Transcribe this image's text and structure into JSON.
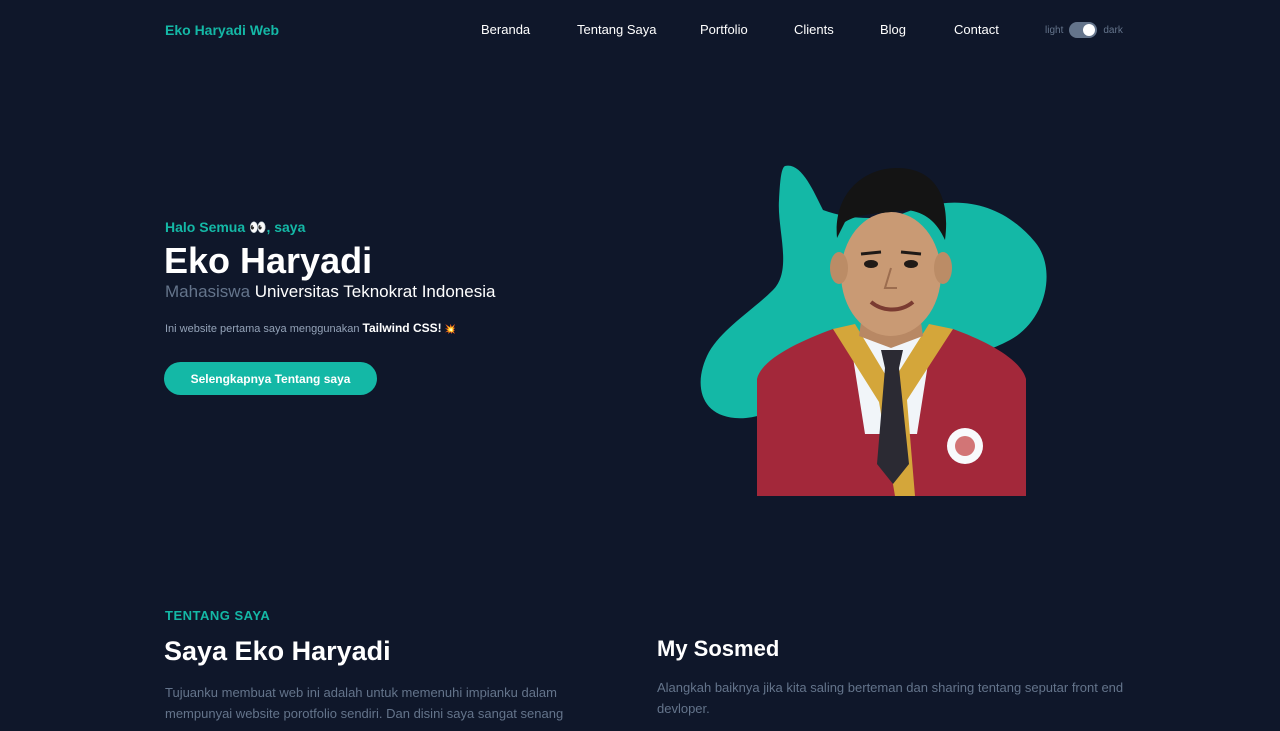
{
  "nav": {
    "brand": "Eko Haryadi Web",
    "items": [
      {
        "label": "Beranda"
      },
      {
        "label": "Tentang Saya"
      },
      {
        "label": "Portfolio"
      },
      {
        "label": "Clients"
      },
      {
        "label": "Blog"
      },
      {
        "label": "Contact"
      }
    ],
    "theme_light": "light",
    "theme_dark": "dark"
  },
  "hero": {
    "greeting": "Halo Semua 👀, saya",
    "name": "Eko Haryadi",
    "role_muted": "Mahasiswa",
    "role": "Universitas Teknokrat Indonesia",
    "desc": "Ini website pertama saya menggunakan",
    "desc_bold": "Tailwind CSS!",
    "desc_emoji": "💥",
    "button": "Selengkapnya Tentang saya"
  },
  "about": {
    "label": "TENTANG SAYA",
    "title": "Saya Eko Haryadi",
    "text": "Tujuanku membuat web ini adalah untuk memenuhi impianku dalam mempunyai website porotfolio sendiri. Dan disini saya sangat senang"
  },
  "sosmed": {
    "title": "My Sosmed",
    "text": "Alangkah baiknya jika kita saling berteman dan sharing tentang seputar front end devloper."
  },
  "colors": {
    "background": "#0f172a",
    "accent": "#14b8a6",
    "muted": "#64748b"
  }
}
